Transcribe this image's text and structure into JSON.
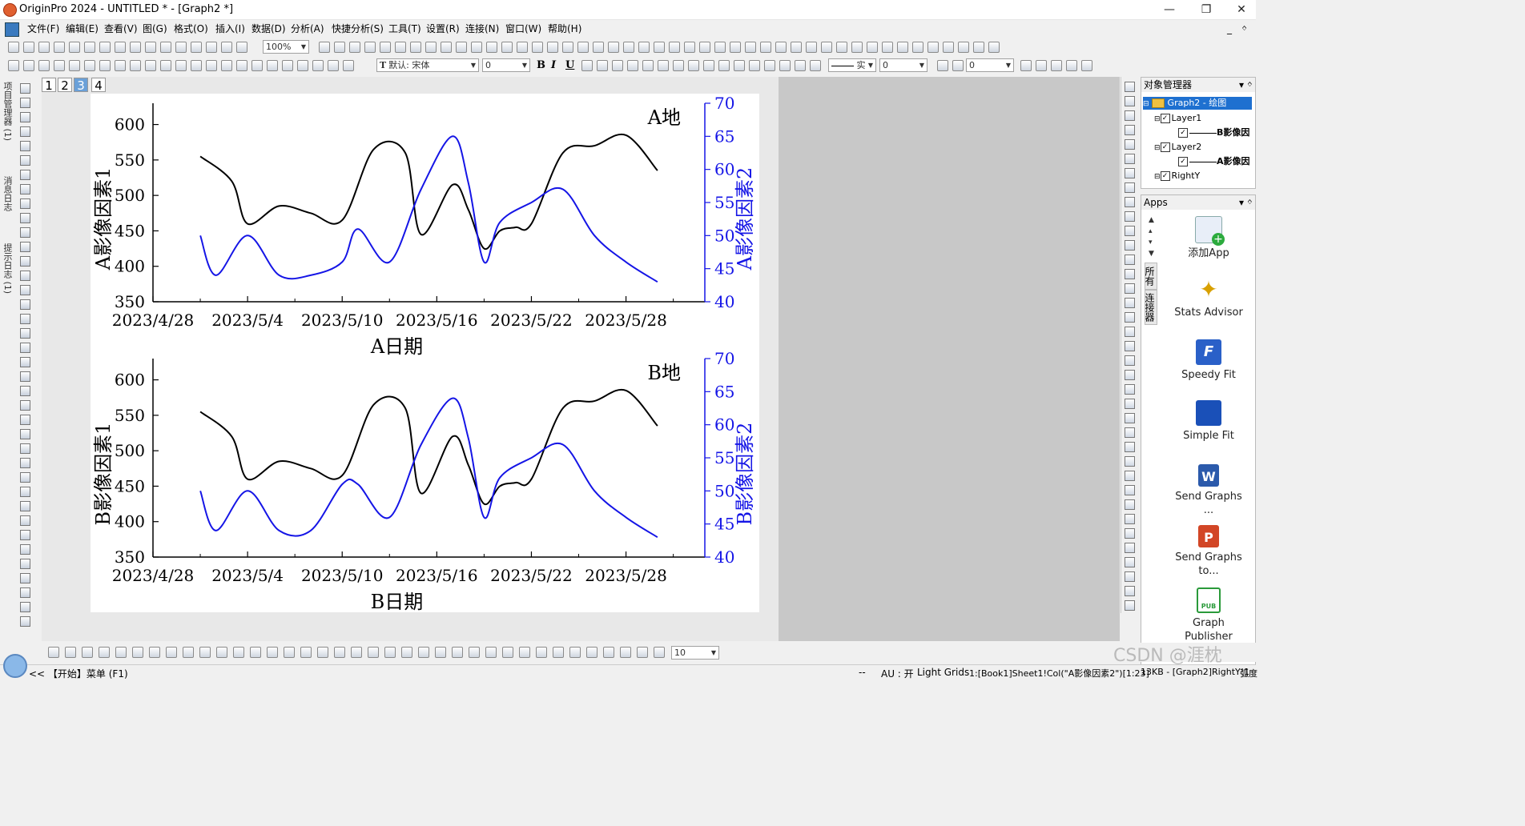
{
  "window": {
    "title": "OriginPro 2024 - UNTITLED * - [Graph2 *]",
    "minimize": "—",
    "restore": "❐",
    "close": "✕",
    "mdi_min": "_",
    "mdi_pin": "ᛜ"
  },
  "menu": [
    "文件(F)",
    "编辑(E)",
    "查看(V)",
    "图(G)",
    "格式(O)",
    "插入(I)",
    "数据(D)",
    "分析(A)",
    "快捷分析(S)",
    "工具(T)",
    "设置(R)",
    "连接(N)",
    "窗口(W)",
    "帮助(H)"
  ],
  "toolbar": {
    "zoom": "100%",
    "font_name": "默认: 宋体",
    "font_size": "0",
    "bold": "B",
    "italic": "I",
    "underline": "U",
    "line_style": "实",
    "line_width": "0",
    "fill_value": "0",
    "bottom_size": "10"
  },
  "left_tabs": [
    "项目管理器 (1)",
    "消息日志",
    "提示日志 (1)"
  ],
  "layer_tabs": [
    "1",
    "2",
    "3",
    "4"
  ],
  "active_layer": "3",
  "colors": {
    "series_black": "#000000",
    "series_blue": "#1515e6",
    "axis_blue": "#1515e6"
  },
  "chart_data": [
    {
      "type": "line",
      "title": "A地",
      "xlabel": "A日期",
      "ylabel_left": "A影像因素1",
      "ylabel_right": "A影像因素2",
      "x_ticks": [
        "2023/4/28",
        "2023/5/4",
        "2023/5/10",
        "2023/5/16",
        "2023/5/22",
        "2023/5/28"
      ],
      "xlim": [
        "2023-04-28",
        "2023-06-02"
      ],
      "ylim_left": [
        350,
        630
      ],
      "y_ticks_left": [
        "350",
        "400",
        "450",
        "500",
        "550",
        "600"
      ],
      "ylim_right": [
        40,
        70
      ],
      "y_ticks_right": [
        "40",
        "45",
        "50",
        "55",
        "60",
        "65",
        "70"
      ],
      "grid": false,
      "series": [
        {
          "axis": "left",
          "color": "#000000",
          "x": [
            "2023-05-01",
            "2023-05-03",
            "2023-05-04",
            "2023-05-06",
            "2023-05-08",
            "2023-05-10",
            "2023-05-12",
            "2023-05-14",
            "2023-05-15",
            "2023-05-17",
            "2023-05-18",
            "2023-05-19",
            "2023-05-20",
            "2023-05-21",
            "2023-05-22",
            "2023-05-24",
            "2023-05-26",
            "2023-05-28",
            "2023-05-30"
          ],
          "y": [
            555,
            520,
            460,
            485,
            475,
            465,
            565,
            560,
            445,
            515,
            480,
            425,
            450,
            455,
            460,
            560,
            570,
            585,
            535
          ]
        },
        {
          "axis": "right",
          "color": "#1515e6",
          "x": [
            "2023-05-01",
            "2023-05-02",
            "2023-05-04",
            "2023-05-06",
            "2023-05-08",
            "2023-05-10",
            "2023-05-11",
            "2023-05-13",
            "2023-05-15",
            "2023-05-17",
            "2023-05-18",
            "2023-05-19",
            "2023-05-20",
            "2023-05-22",
            "2023-05-24",
            "2023-05-26",
            "2023-05-28",
            "2023-05-30"
          ],
          "y": [
            50,
            44,
            50,
            44,
            44,
            46,
            51,
            46,
            57,
            65,
            58,
            46,
            52,
            55,
            57,
            50,
            46,
            43
          ]
        }
      ]
    },
    {
      "type": "line",
      "title": "B地",
      "xlabel": "B日期",
      "ylabel_left": "B影像因素1",
      "ylabel_right": "B影像因素2",
      "x_ticks": [
        "2023/4/28",
        "2023/5/4",
        "2023/5/10",
        "2023/5/16",
        "2023/5/22",
        "2023/5/28"
      ],
      "xlim": [
        "2023-04-28",
        "2023-06-02"
      ],
      "ylim_left": [
        350,
        630
      ],
      "y_ticks_left": [
        "350",
        "400",
        "450",
        "500",
        "550",
        "600"
      ],
      "ylim_right": [
        40,
        70
      ],
      "y_ticks_right": [
        "40",
        "45",
        "50",
        "55",
        "60",
        "65",
        "70"
      ],
      "grid": false,
      "series": [
        {
          "axis": "left",
          "color": "#000000",
          "x": [
            "2023-05-01",
            "2023-05-03",
            "2023-05-04",
            "2023-05-06",
            "2023-05-08",
            "2023-05-10",
            "2023-05-12",
            "2023-05-14",
            "2023-05-15",
            "2023-05-17",
            "2023-05-18",
            "2023-05-19",
            "2023-05-20",
            "2023-05-21",
            "2023-05-22",
            "2023-05-24",
            "2023-05-26",
            "2023-05-28",
            "2023-05-30"
          ],
          "y": [
            555,
            520,
            460,
            485,
            475,
            465,
            565,
            560,
            440,
            520,
            480,
            425,
            450,
            455,
            460,
            560,
            570,
            585,
            535
          ]
        },
        {
          "axis": "right",
          "color": "#1515e6",
          "x": [
            "2023-05-01",
            "2023-05-02",
            "2023-05-04",
            "2023-05-06",
            "2023-05-08",
            "2023-05-10",
            "2023-05-11",
            "2023-05-13",
            "2023-05-15",
            "2023-05-17",
            "2023-05-18",
            "2023-05-19",
            "2023-05-20",
            "2023-05-22",
            "2023-05-24",
            "2023-05-26",
            "2023-05-28",
            "2023-05-30"
          ],
          "y": [
            50,
            44,
            50,
            44,
            44,
            51,
            51,
            46,
            57,
            64,
            58,
            46,
            52,
            55,
            57,
            50,
            46,
            43
          ]
        }
      ]
    }
  ],
  "object_manager": {
    "title": "对象管理器",
    "root": "Graph2 - 绘图",
    "layer1": "Layer1",
    "layer1_plot": "B影像因",
    "layer2": "Layer2",
    "layer2_plot": "A影像因",
    "righty": "RightY"
  },
  "apps": {
    "title": "Apps",
    "tab_all": "所有",
    "tab_conn": "连接器",
    "items": [
      "添加App",
      "Stats Advisor",
      "Speedy Fit",
      "Simple Fit",
      "Send Graphs ...",
      "Send Graphs to...",
      "Graph Publisher"
    ]
  },
  "status": {
    "start": "<<  【开始】菜单 (F1)",
    "dashes": "--",
    "au": "AU : 开",
    "grids": "Light Grids",
    "cell": "1:[Book1]Sheet1!Col(\"A影像因素2\")[1:23]",
    "size": "13KB - [Graph2]RightY!1",
    "angle": "弧度",
    "watermark": "CSDN @涯枕"
  }
}
